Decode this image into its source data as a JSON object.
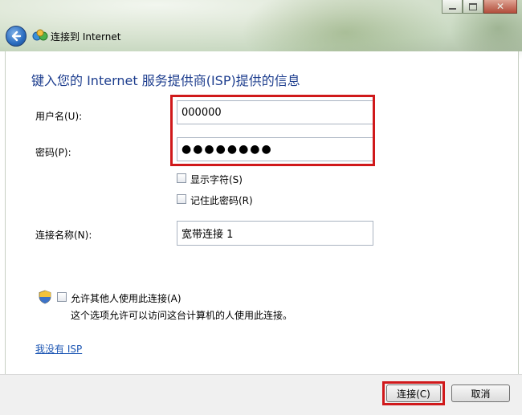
{
  "window": {
    "title": "连接到 Internet",
    "close_glyph": "✕"
  },
  "form": {
    "heading": "键入您的 Internet 服务提供商(ISP)提供的信息",
    "username_label": "用户名(U):",
    "username_value": "000000",
    "password_label": "密码(P):",
    "password_value": "●●●●●●●●",
    "show_chars_label": "显示字符(S)",
    "remember_pw_label": "记住此密码(R)",
    "conn_name_label": "连接名称(N):",
    "conn_name_value": "宽带连接 1",
    "allow_others_label": "允许其他人使用此连接(A)",
    "allow_others_desc": "这个选项允许可以访问这台计算机的人使用此连接。",
    "no_isp_link": "我没有 ISP"
  },
  "buttons": {
    "connect": "连接(C)",
    "cancel": "取消"
  },
  "colors": {
    "heading": "#1f3f8f",
    "highlight": "#d0191b",
    "link": "#1b55b3"
  }
}
